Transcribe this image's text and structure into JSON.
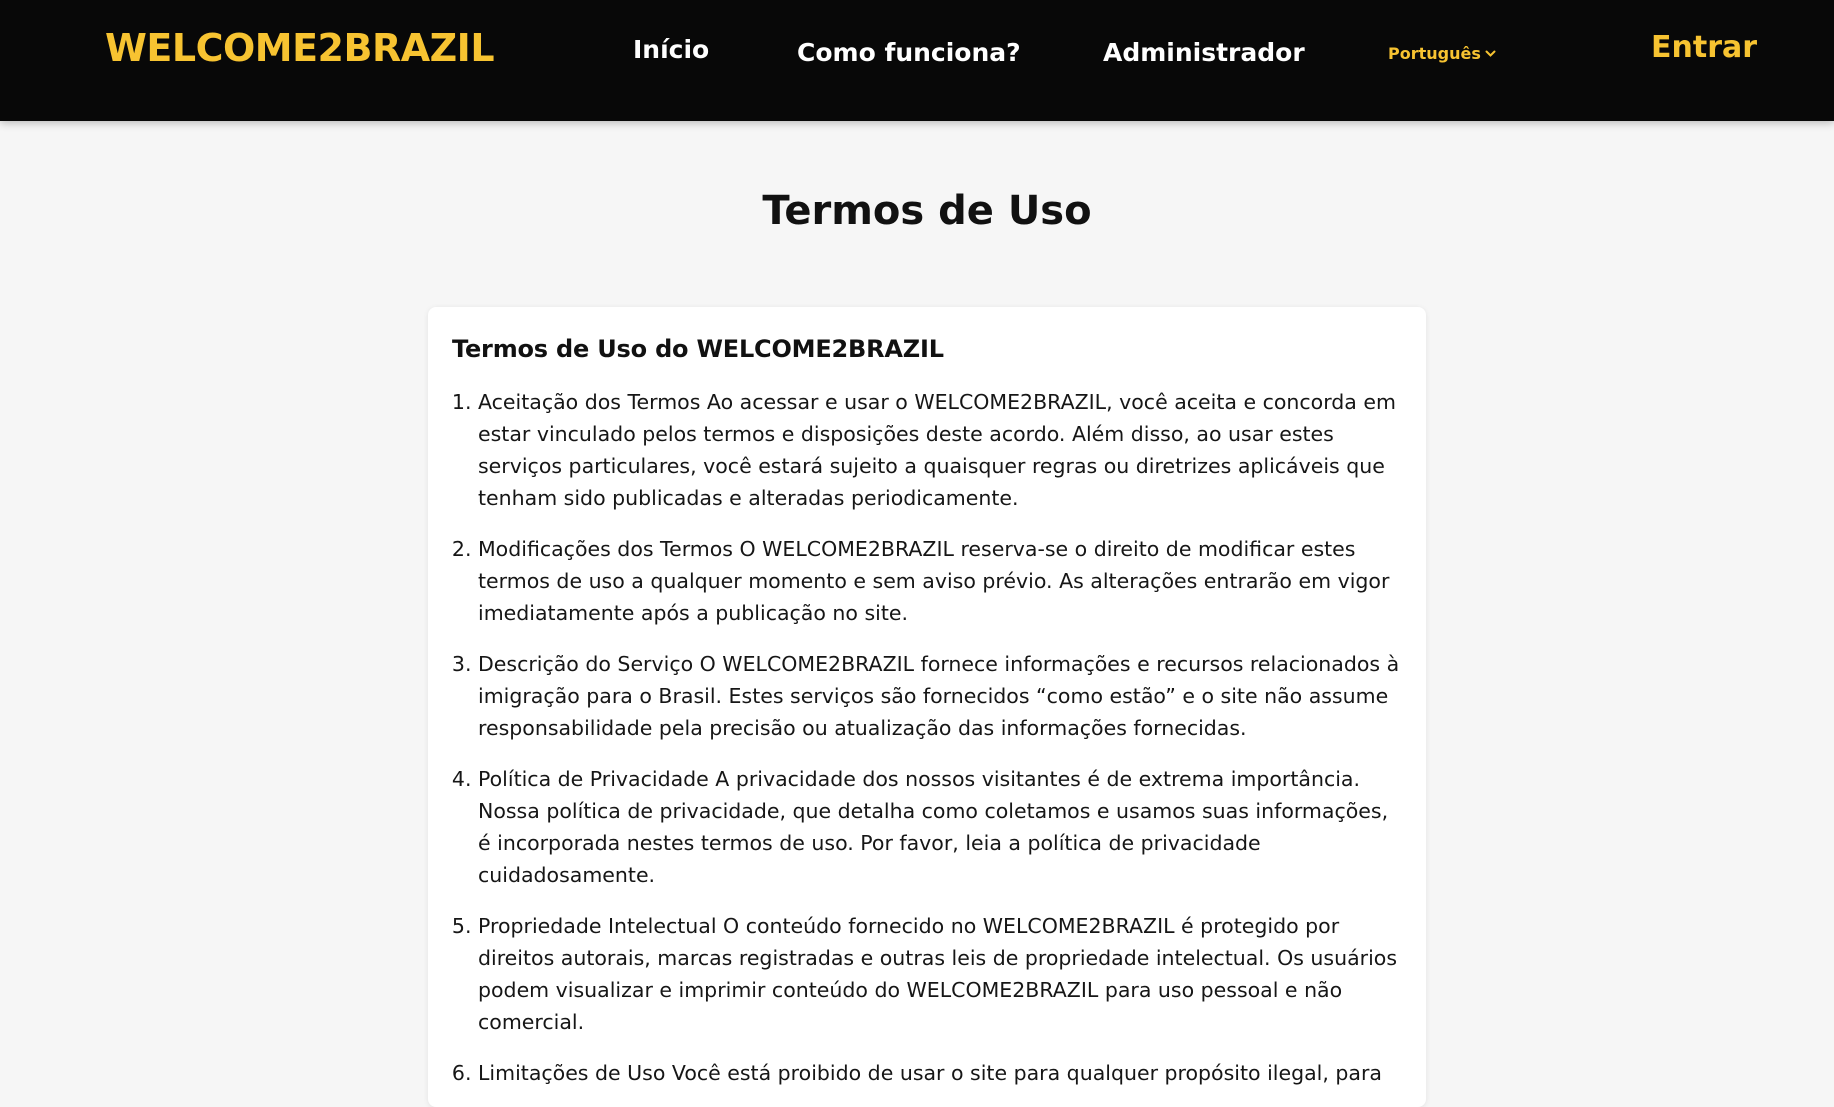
{
  "header": {
    "logo": "WELCOME2BRAZIL",
    "nav": {
      "inicio": "Início",
      "como_funciona": "Como funciona?",
      "administrador": "Administrador"
    },
    "language": "Português",
    "language_icon": "chevron-down-icon",
    "login": "Entrar"
  },
  "colors": {
    "header_bg": "#080808",
    "accent": "#f7c331",
    "page_bg": "#f6f6f6",
    "card_bg": "#ffffff"
  },
  "main": {
    "page_title": "Termos de Uso",
    "card": {
      "heading": "Termos de Uso do WELCOME2BRAZIL",
      "items": [
        "Aceitação dos Termos Ao acessar e usar o WELCOME2BRAZIL, você aceita e concorda em estar vinculado pelos termos e disposições deste acordo. Além disso, ao usar estes serviços particulares, você estará sujeito a quaisquer regras ou diretrizes aplicáveis que tenham sido publicadas e alteradas periodicamente.",
        "Modificações dos Termos O WELCOME2BRAZIL reserva-se o direito de modificar estes termos de uso a qualquer momento e sem aviso prévio. As alterações entrarão em vigor imediatamente após a publicação no site.",
        "Descrição do Serviço O WELCOME2BRAZIL fornece informações e recursos relacionados à imigração para o Brasil. Estes serviços são fornecidos “como estão” e o site não assume responsabilidade pela precisão ou atualização das informações fornecidas.",
        "Política de Privacidade A privacidade dos nossos visitantes é de extrema importância. Nossa política de privacidade, que detalha como coletamos e usamos suas informações, é incorporada nestes termos de uso. Por favor, leia a política de privacidade cuidadosamente.",
        "Propriedade Intelectual O conteúdo fornecido no WELCOME2BRAZIL é protegido por direitos autorais, marcas registradas e outras leis de propriedade intelectual. Os usuários podem visualizar e imprimir conteúdo do WELCOME2BRAZIL para uso pessoal e não comercial.",
        "Limitações de Uso Você está proibido de usar o site para qualquer propósito ilegal, para"
      ]
    }
  }
}
